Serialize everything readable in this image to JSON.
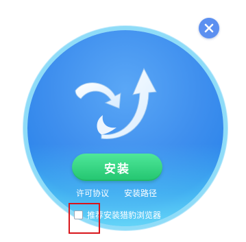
{
  "close_button": {
    "icon": "close-icon",
    "color": "#5b8ff0"
  },
  "installer": {
    "logo_icon": "cheetah-swirl-arrow-icon",
    "install_label": "安装",
    "links": {
      "license": "许可协议",
      "install_path": "安装路径"
    },
    "recommend": {
      "label": "推荐安装猎豹浏览器",
      "checked": false
    }
  },
  "colors": {
    "disc_blue": "#3f8fee",
    "disc_cyan": "#46c8f2",
    "button_green": "#23c56f",
    "highlight_red": "#d8141a"
  }
}
